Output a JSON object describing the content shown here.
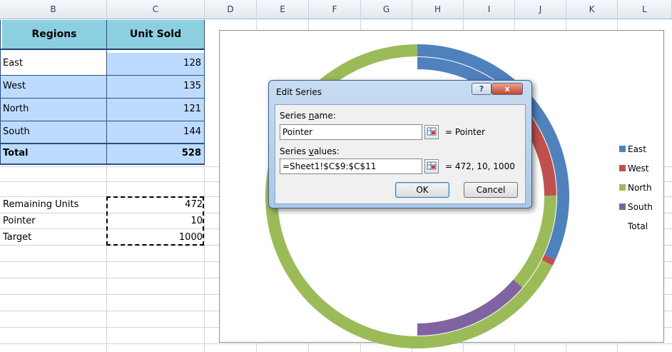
{
  "columns": [
    "B",
    "C",
    "D",
    "E",
    "F",
    "G",
    "H",
    "I",
    "J",
    "K",
    "L"
  ],
  "table": {
    "headers": [
      "Regions",
      "Unit Sold"
    ],
    "rows": [
      {
        "region": "East",
        "units": "128"
      },
      {
        "region": "West",
        "units": "135"
      },
      {
        "region": "North",
        "units": "121"
      },
      {
        "region": "South",
        "units": "144"
      }
    ],
    "total": {
      "label": "Total",
      "units": "528"
    }
  },
  "extra": {
    "rows": [
      {
        "label": "Remaining Units",
        "value": "472"
      },
      {
        "label": "Pointer",
        "value": "10"
      },
      {
        "label": "Target",
        "value": "1000"
      }
    ]
  },
  "legend": {
    "items": [
      {
        "label": "East",
        "color": "#4f81bd"
      },
      {
        "label": "West",
        "color": "#c0504d"
      },
      {
        "label": "North",
        "color": "#9bbb59"
      },
      {
        "label": "South",
        "color": "#8064a2"
      },
      {
        "label": "Total",
        "color": ""
      }
    ]
  },
  "colors": {
    "east": "#4f81bd",
    "west": "#c0504d",
    "north": "#9bbb59",
    "south": "#8064a2",
    "header_fill": "#8ccfe0",
    "cell_fill": "#bddbff"
  },
  "dialog": {
    "title": "Edit Series",
    "help_label": "?",
    "close_label": "x",
    "series_name_label_pre": "Series ",
    "series_name_label_ul": "n",
    "series_name_label_post": "ame:",
    "series_name_value": "Pointer",
    "series_name_preview": "= Pointer",
    "series_values_label_pre": "Series ",
    "series_values_label_ul": "v",
    "series_values_label_post": "alues:",
    "series_values_value": "=Sheet1!$C$9:$C$11",
    "series_values_preview": "= 472, 10, 1000",
    "ok_label": "OK",
    "cancel_label": "Cancel"
  },
  "chart_data": {
    "type": "pie",
    "series": [
      {
        "values": [
          128,
          135,
          121,
          144,
          528
        ]
      },
      {
        "name": "Pointer",
        "values": [
          472,
          10,
          1000
        ]
      }
    ],
    "categories": [
      "East",
      "West",
      "North",
      "South",
      "Total"
    ],
    "legend": "right"
  }
}
